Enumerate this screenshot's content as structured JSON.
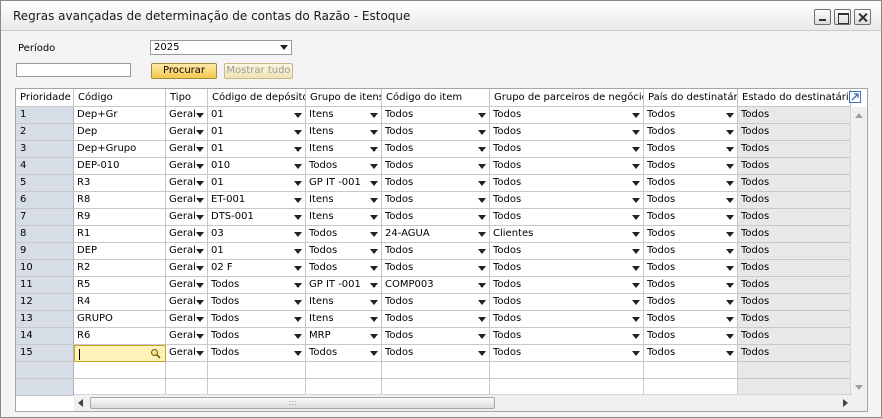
{
  "window": {
    "title": "Regras avançadas de determinação de contas do Razão - Estoque"
  },
  "filters": {
    "period_label": "Período",
    "period_value": "2025",
    "search_value": "",
    "search_button": "Procurar",
    "show_all_button": "Mostrar tudo"
  },
  "table": {
    "columns": [
      "Prioridade",
      "Código",
      "Tipo",
      "Código de depósito",
      "Grupo de itens",
      "Código do item",
      "Grupo de parceiros de negócios",
      "País do destinatário",
      "Estado do destinatário"
    ],
    "rows": [
      {
        "n": "1",
        "codigo": "Dep+Gr",
        "tipo": "Geral",
        "deposito": "01",
        "grupo": "Itens",
        "item": "Todos",
        "parceiros": "Todos",
        "pais": "Todos",
        "estado": "Todos"
      },
      {
        "n": "2",
        "codigo": "Dep",
        "tipo": "Geral",
        "deposito": "01",
        "grupo": "Itens",
        "item": "Todos",
        "parceiros": "Todos",
        "pais": "Todos",
        "estado": "Todos"
      },
      {
        "n": "3",
        "codigo": "Dep+Grupo",
        "tipo": "Geral",
        "deposito": "01",
        "grupo": "Itens",
        "item": "Todos",
        "parceiros": "Todos",
        "pais": "Todos",
        "estado": "Todos"
      },
      {
        "n": "4",
        "codigo": "DEP-010",
        "tipo": "Geral",
        "deposito": "010",
        "grupo": "Todos",
        "item": "Todos",
        "parceiros": "Todos",
        "pais": "Todos",
        "estado": "Todos"
      },
      {
        "n": "5",
        "codigo": "R3",
        "tipo": "Geral",
        "deposito": "01",
        "grupo": "GP IT -001",
        "item": "Todos",
        "parceiros": "Todos",
        "pais": "Todos",
        "estado": "Todos"
      },
      {
        "n": "6",
        "codigo": "R8",
        "tipo": "Geral",
        "deposito": "ET-001",
        "grupo": "Itens",
        "item": "Todos",
        "parceiros": "Todos",
        "pais": "Todos",
        "estado": "Todos"
      },
      {
        "n": "7",
        "codigo": "R9",
        "tipo": "Geral",
        "deposito": "DTS-001",
        "grupo": "Itens",
        "item": "Todos",
        "parceiros": "Todos",
        "pais": "Todos",
        "estado": "Todos"
      },
      {
        "n": "8",
        "codigo": "R1",
        "tipo": "Geral",
        "deposito": "03",
        "grupo": "Todos",
        "item": "24-AGUA",
        "parceiros": "Clientes",
        "pais": "Todos",
        "estado": "Todos"
      },
      {
        "n": "9",
        "codigo": "DEP",
        "tipo": "Geral",
        "deposito": "01",
        "grupo": "Todos",
        "item": "Todos",
        "parceiros": "Todos",
        "pais": "Todos",
        "estado": "Todos"
      },
      {
        "n": "10",
        "codigo": "R2",
        "tipo": "Geral",
        "deposito": "02 F",
        "grupo": "Todos",
        "item": "Todos",
        "parceiros": "Todos",
        "pais": "Todos",
        "estado": "Todos"
      },
      {
        "n": "11",
        "codigo": "R5",
        "tipo": "Geral",
        "deposito": "Todos",
        "grupo": "GP IT -001",
        "item": "COMP003",
        "parceiros": "Todos",
        "pais": "Todos",
        "estado": "Todos"
      },
      {
        "n": "12",
        "codigo": "R4",
        "tipo": "Geral",
        "deposito": "Todos",
        "grupo": "Itens",
        "item": "Todos",
        "parceiros": "Todos",
        "pais": "Todos",
        "estado": "Todos"
      },
      {
        "n": "13",
        "codigo": "GRUPO",
        "tipo": "Geral",
        "deposito": "Todos",
        "grupo": "Itens",
        "item": "Todos",
        "parceiros": "Todos",
        "pais": "Todos",
        "estado": "Todos"
      },
      {
        "n": "14",
        "codigo": "R6",
        "tipo": "Geral",
        "deposito": "Todos",
        "grupo": "MRP",
        "item": "Todos",
        "parceiros": "Todos",
        "pais": "Todos",
        "estado": "Todos"
      },
      {
        "n": "15",
        "codigo": "",
        "tipo": "Geral",
        "deposito": "Todos",
        "grupo": "Todos",
        "item": "Todos",
        "parceiros": "Todos",
        "pais": "Todos",
        "estado": "Todos"
      }
    ]
  },
  "colors": {
    "accent_button": "#f5c84f",
    "row_number_bg": "#d6dde6",
    "edit_cell_bg": "#fff2b8"
  }
}
